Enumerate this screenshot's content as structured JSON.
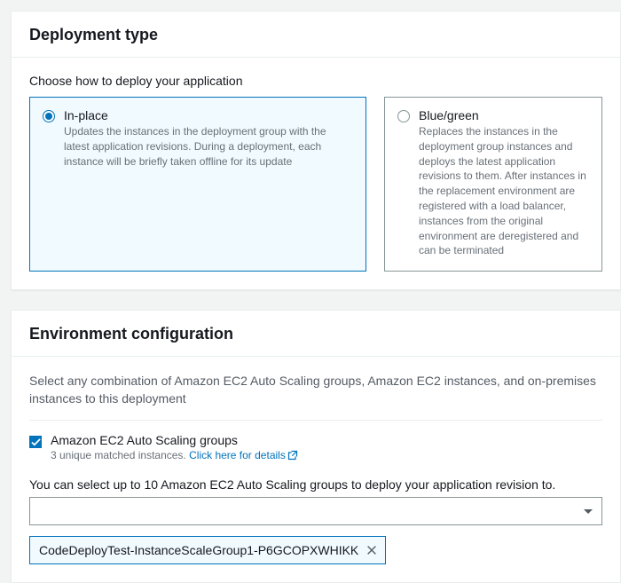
{
  "deployment": {
    "heading": "Deployment type",
    "choose_label": "Choose how to deploy your application",
    "options": {
      "in_place": {
        "title": "In-place",
        "desc": "Updates the instances in the deployment group with the latest application revisions. During a deployment, each instance will be briefly taken offline for its update"
      },
      "blue_green": {
        "title": "Blue/green",
        "desc": "Replaces the instances in the deployment group instances and deploys the latest application revisions to them. After instances in the replacement environment are registered with a load balancer, instances from the original environment are deregistered and can be terminated"
      }
    }
  },
  "env": {
    "heading": "Environment configuration",
    "desc": "Select any combination of Amazon EC2 Auto Scaling groups, Amazon EC2 instances, and on-premises instances to this deployment",
    "asg_checkbox_label": "Amazon EC2 Auto Scaling groups",
    "asg_sub_prefix": "3 unique matched instances. ",
    "asg_sub_link": "Click here for details",
    "select_label": "You can select up to 10 Amazon EC2 Auto Scaling groups to deploy your application revision to.",
    "token_value": "CodeDeployTest-InstanceScaleGroup1-P6GCOPXWHIKK"
  }
}
